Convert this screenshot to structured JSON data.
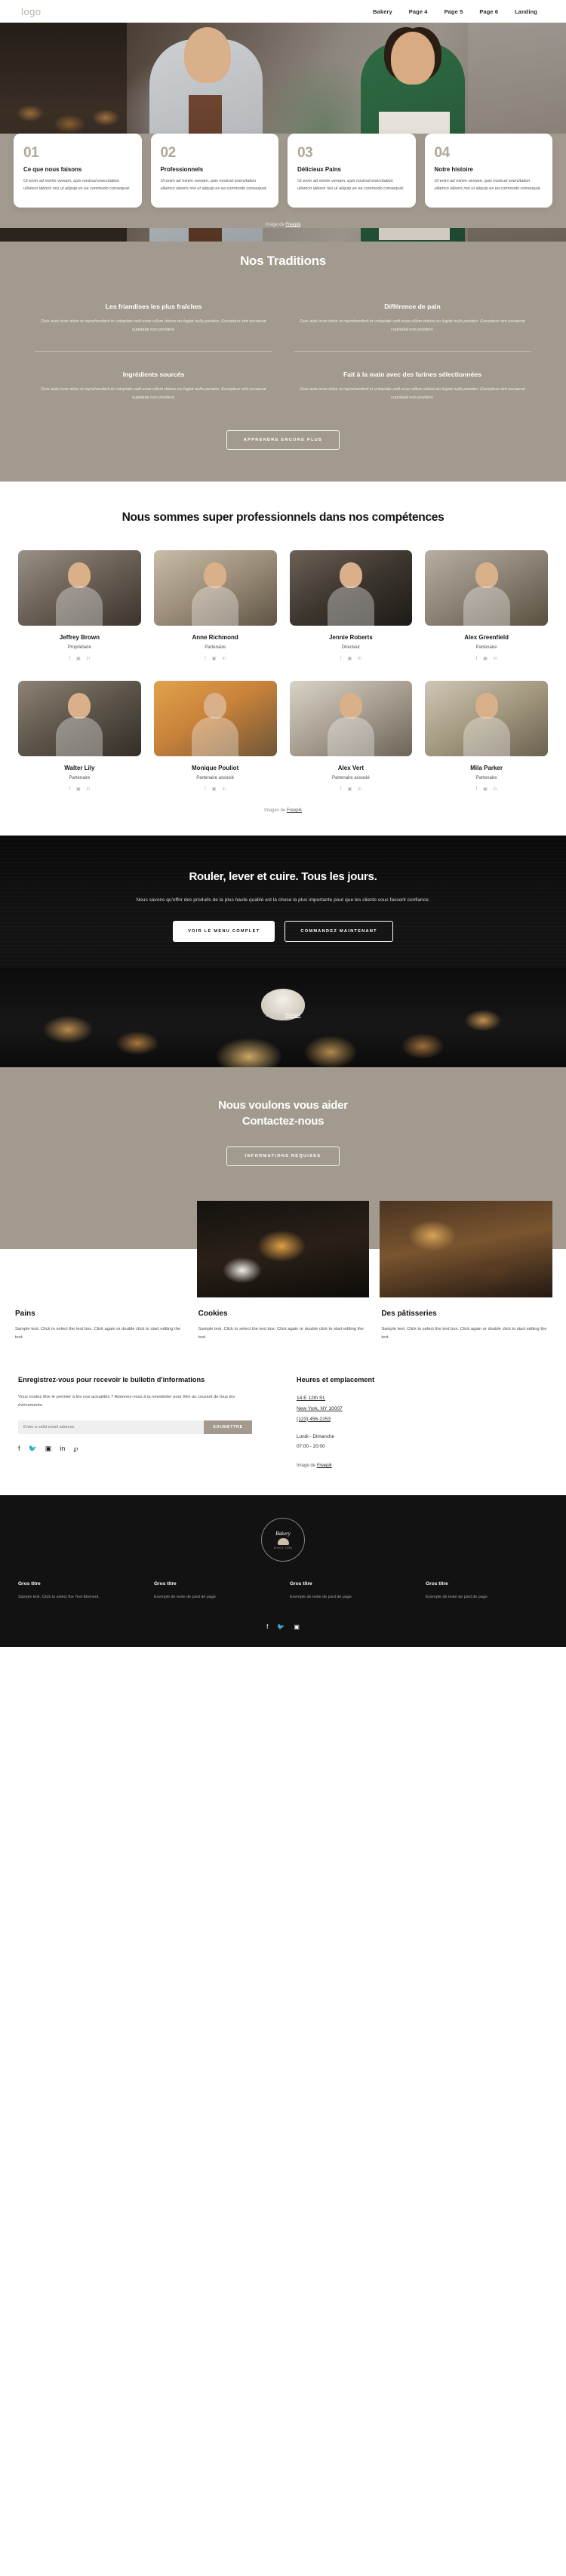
{
  "header": {
    "logo": "logo",
    "nav": [
      "Bakery",
      "Page 4",
      "Page 5",
      "Page 6",
      "Landing"
    ]
  },
  "hero": {
    "credit_prefix": "Image de ",
    "credit_link": "Freepik"
  },
  "feature_cards": [
    {
      "num": "01",
      "title": "Ce que nous faisons",
      "desc": "Ut enim ad minim veniam, quis nostrud exercitation ullamco laboris nisi ut aliquip ex ea commodo consequat."
    },
    {
      "num": "02",
      "title": "Professionnels",
      "desc": "Ut enim ad minim veniam, quis nostrud exercitation ullamco laboris nisi ut aliquip ex ea commodo consequat."
    },
    {
      "num": "03",
      "title": "Délicieux Pains",
      "desc": "Ut enim ad minim veniam, quis nostrud exercitation ullamco laboris nisi ut aliquip ex ea commodo consequat."
    },
    {
      "num": "04",
      "title": "Notre histoire",
      "desc": "Ut enim ad minim veniam, quis nostrud exercitation ullamco laboris nisi ut aliquip ex ea commodo consequat."
    }
  ],
  "traditions": {
    "title": "Nos Traditions",
    "items": [
      {
        "heading": "Les friandises les plus fraîches",
        "text": "Duis aute irure dolor in reprehenderit in voluptate velit esse cillum dolore eu fugiat nulla pariatur. Excepteur sint occaecat cupidatat non proident."
      },
      {
        "heading": "Différence de pain",
        "text": "Duis aute irure dolor in reprehenderit in voluptate velit esse cillum dolore eu fugiat nulla pariatur. Excepteur sint occaecat cupidatat non proident."
      },
      {
        "heading": "Ingrédients sourcés",
        "text": "Duis aute irure dolor in reprehenderit in voluptate velit esse cillum dolore eu fugiat nulla pariatur. Excepteur sint occaecat cupidatat non proident."
      },
      {
        "heading": "Fait à la main avec des farines sélectionnées",
        "text": "Duis aute irure dolor in reprehenderit in voluptate velit esse cillum dolore eu fugiat nulla pariatur. Excepteur sint occaecat cupidatat non proident."
      }
    ],
    "button": "APPRENDRE ENCORE PLUS"
  },
  "team": {
    "title": "Nous sommes super professionnels dans nos compétences",
    "members": [
      {
        "name": "Jeffrey Brown",
        "role": "Propriétaire"
      },
      {
        "name": "Anne Richmond",
        "role": "Partenaire"
      },
      {
        "name": "Jennie Roberts",
        "role": "Directeur"
      },
      {
        "name": "Alex Greenfield",
        "role": "Partenaire"
      },
      {
        "name": "Walter Lily",
        "role": "Partenaire"
      },
      {
        "name": "Monique Pouliot",
        "role": "Partenaire associé"
      },
      {
        "name": "Alex Vert",
        "role": "Partenaire associé"
      },
      {
        "name": "Mila Parker",
        "role": "Partenaire"
      }
    ],
    "social_icons": [
      "facebook-icon",
      "instagram-icon",
      "linkedin-icon"
    ],
    "credit_prefix": "Images de ",
    "credit_link": "Freepik"
  },
  "cta": {
    "title": "Rouler, lever et cuire. Tous les jours.",
    "subtitle": "Nous savons qu'offrir des produits de la plus haute qualité est la chose la plus importante pour que les clients vous fassent confiance.",
    "primary_button": "VOIR LE MENU COMPLET",
    "secondary_button": "COMMANDEZ MAINTENANT",
    "credit_prefix": "Image de ",
    "credit_link": "Freepik"
  },
  "contact": {
    "title_line1": "Nous voulons vous aider",
    "title_line2": "Contactez-nous",
    "button": "INFORMATIONS REQUISES"
  },
  "products": [
    {
      "title": "Pains",
      "desc": "Sample text. Click to select the text box. Click again or double click to start editing the text."
    },
    {
      "title": "Cookies",
      "desc": "Sample text. Click to select the text box. Click again or double click to start editing the text."
    },
    {
      "title": "Des pâtisseries",
      "desc": "Sample text. Click to select the text box. Click again or double click to start editing the text."
    }
  ],
  "newsletter": {
    "heading": "Enregistrez-vous pour recevoir le bulletin d'informations",
    "text": "Vous voulez être le premier à lire nos actualités ? Abonnez-vous à la newsletter pour être au courant de tous les événements.",
    "placeholder": "Enter a valid email address",
    "submit": "SOUMETTRE",
    "socials": [
      "facebook-icon",
      "twitter-icon",
      "instagram-icon",
      "linkedin-icon",
      "pinterest-icon"
    ]
  },
  "location": {
    "heading": "Heures et emplacement",
    "address_line1": "14 E 12th St,",
    "address_line2": "New York, NY 10007",
    "phone": "(123) 456-2253",
    "days": "Lundi - Dimanche",
    "hours": "07:00 - 20:00",
    "credit_prefix": "Image de ",
    "credit_link": "Freepik"
  },
  "footer": {
    "brand": "Bakery",
    "brand_sub": "SINCE 1985",
    "columns": [
      {
        "heading": "Gros titre",
        "text": "Sample text. Click to select the Text Element."
      },
      {
        "heading": "Gros titre",
        "text": "Exemple de texte de pied de page"
      },
      {
        "heading": "Gros titre",
        "text": "Exemple de texte de pied de page"
      },
      {
        "heading": "Gros titre",
        "text": "Exemple de texte de pied de page"
      }
    ],
    "socials": [
      "facebook-icon",
      "twitter-icon",
      "instagram-icon"
    ]
  },
  "colors": {
    "beige": "#a29a8e",
    "dark": "#121212",
    "white": "#ffffff"
  }
}
